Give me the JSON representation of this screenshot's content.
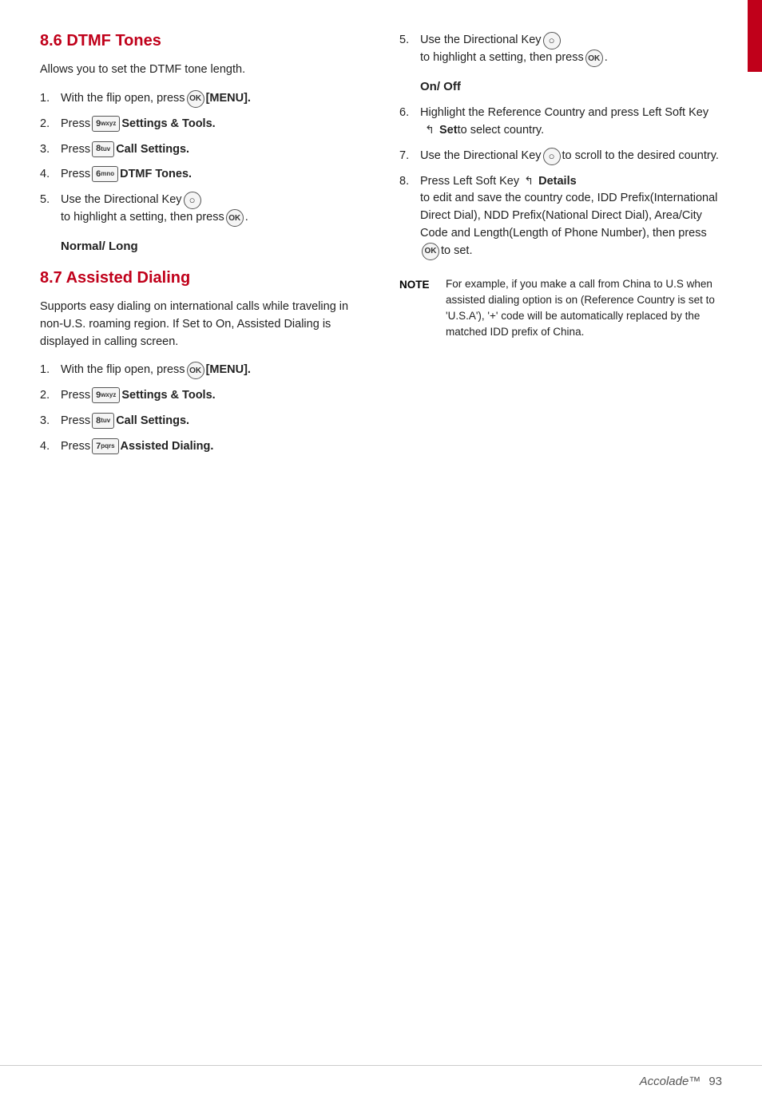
{
  "page": {
    "footer": {
      "brand": "Accolade™",
      "page_number": "93"
    }
  },
  "section_86": {
    "title": "8.6 DTMF Tones",
    "intro": "Allows you to set the DTMF tone length.",
    "steps": [
      {
        "num": "1.",
        "text_before": "With the flip open, press",
        "icon": "ok",
        "text_after": "[MENU]."
      },
      {
        "num": "2.",
        "text_before": "Press",
        "key": "9wxyz",
        "text_after": "Settings & Tools."
      },
      {
        "num": "3.",
        "text_before": "Press",
        "key": "8tuv",
        "text_after": "Call Settings."
      },
      {
        "num": "4.",
        "text_before": "Press",
        "key": "6mno",
        "text_after": "DTMF Tones."
      },
      {
        "num": "5.",
        "text_before": "Use the Directional Key",
        "icon": "dir",
        "text_to": "to",
        "text_after": "highlight a setting, then press",
        "icon2": "ok",
        "text_end": "."
      }
    ],
    "subheading": "Normal/ Long"
  },
  "section_87": {
    "title": "8.7 Assisted Dialing",
    "intro": "Supports easy dialing on international calls while traveling in non-U.S. roaming region. If Set to On, Assisted Dialing is displayed in calling screen.",
    "steps": [
      {
        "num": "1.",
        "text_before": "With the flip open, press",
        "icon": "ok",
        "text_after": "[MENU]."
      },
      {
        "num": "2.",
        "text_before": "Press",
        "key": "9wxyz",
        "text_after": "Settings & Tools."
      },
      {
        "num": "3.",
        "text_before": "Press",
        "key": "8tuv",
        "text_after": "Call Settings."
      },
      {
        "num": "4.",
        "text_before": "Press",
        "key": "7pqrs",
        "text_after": "Assisted Dialing."
      }
    ]
  },
  "section_right": {
    "step5": {
      "num": "5.",
      "text_before": "Use the Directional Key",
      "icon": "dir",
      "text_to": "to",
      "text_after": "highlight a setting, then press",
      "icon2": "ok",
      "text_end": "."
    },
    "subheading": "On/ Off",
    "steps": [
      {
        "num": "6.",
        "text_before": "Highlight the Reference Country and press Left Soft Key",
        "icon": "softkey",
        "bold_word": "Set",
        "text_after": "to select country."
      },
      {
        "num": "7.",
        "text_before": "Use the Directional Key",
        "icon": "dir",
        "text_to": "to",
        "text_after": "scroll to the desired country."
      },
      {
        "num": "8.",
        "text_before": "Press Left Soft Key",
        "icon": "softkey",
        "bold_word": "Details",
        "text_after": "to edit and save the country code, IDD Prefix(International Direct Dial), NDD Prefix(National Direct Dial), Area/City Code and Length(Length of Phone Number), then press",
        "icon2": "ok",
        "text_end": "to set."
      }
    ],
    "note": {
      "label": "NOTE",
      "text": "For example, if you make a call from China to U.S when assisted dialing option is on (Reference Country is set to 'U.S.A'), '+' code will be automatically replaced by the matched IDD prefix of China."
    }
  }
}
